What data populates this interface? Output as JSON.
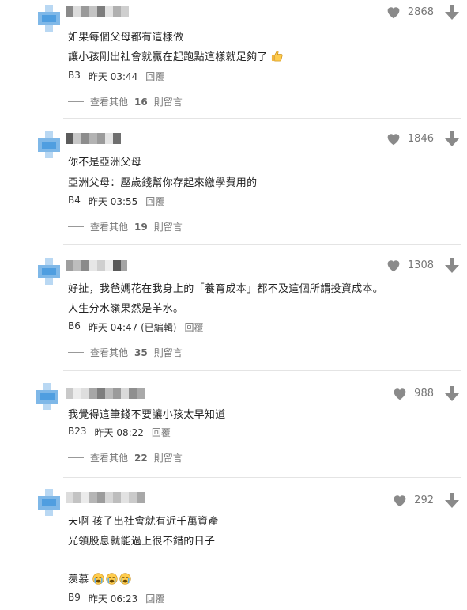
{
  "comments": [
    {
      "lines": [
        "如果每個父母都有這樣做",
        "讓小孩剛出社會就贏在起跑點這樣就足夠了"
      ],
      "has_thumb_emoji": true,
      "likes": "2868",
      "floor": "B3",
      "time": "昨天 03:44",
      "edited": "",
      "reply_label": "回覆",
      "more_prefix": "查看其他",
      "more_count": "16",
      "more_suffix": "則留言"
    },
    {
      "lines": [
        "你不是亞洲父母",
        "亞洲父母：壓歲錢幫你存起來繳學費用的"
      ],
      "likes": "1846",
      "floor": "B4",
      "time": "昨天 03:55",
      "edited": "",
      "reply_label": "回覆",
      "more_prefix": "查看其他",
      "more_count": "19",
      "more_suffix": "則留言"
    },
    {
      "lines": [
        "好扯，我爸媽花在我身上的「養育成本」都不及這個所謂投資成本。",
        "人生分水嶺果然是羊水。"
      ],
      "likes": "1308",
      "floor": "B6",
      "time": "昨天 04:47",
      "edited": "(已編輯)",
      "reply_label": "回覆",
      "more_prefix": "查看其他",
      "more_count": "35",
      "more_suffix": "則留言"
    },
    {
      "lines": [
        "我覺得這筆錢不要讓小孩太早知道"
      ],
      "likes": "988",
      "floor": "B23",
      "time": "昨天 08:22",
      "edited": "",
      "reply_label": "回覆",
      "more_prefix": "查看其他",
      "more_count": "22",
      "more_suffix": "則留言"
    },
    {
      "lines": [
        "天啊 孩子出社會就有近千萬資產",
        "光領股息就能過上很不錯的日子",
        "",
        "羨慕"
      ],
      "likes": "292",
      "floor": "B9",
      "time": "昨天 06:23",
      "edited": "",
      "reply_label": "回覆"
    }
  ],
  "icons": {
    "like": "heart-icon",
    "dislike": "down-arrow-icon",
    "thumb_emoji": "thumbs-up-emoji",
    "cry_emoji": "crying-face-emoji"
  },
  "colors": {
    "icon_gray": "#8a8a8a",
    "avatar_blue": "#7fb8e8",
    "divider": "#e4e4e4"
  }
}
